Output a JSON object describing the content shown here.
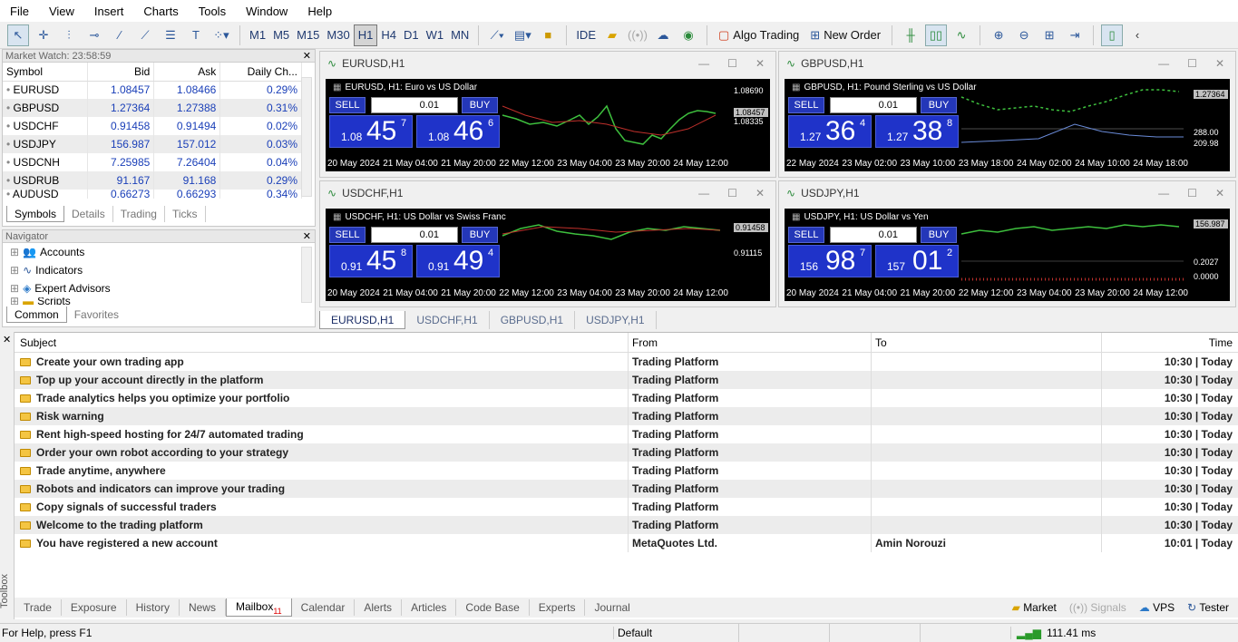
{
  "menu": [
    "File",
    "View",
    "Insert",
    "Charts",
    "Tools",
    "Window",
    "Help"
  ],
  "toolbar": {
    "timeframes": [
      "M1",
      "M5",
      "M15",
      "M30",
      "H1",
      "H4",
      "D1",
      "W1",
      "MN"
    ],
    "active_tf": "H1",
    "ide": "IDE",
    "algo": "Algo Trading",
    "new_order": "New Order"
  },
  "market_watch": {
    "title": "Market Watch: 23:58:59",
    "headers": [
      "Symbol",
      "Bid",
      "Ask",
      "Daily Ch..."
    ],
    "rows": [
      [
        "EURUSD",
        "1.08457",
        "1.08466",
        "0.29%"
      ],
      [
        "GBPUSD",
        "1.27364",
        "1.27388",
        "0.31%"
      ],
      [
        "USDCHF",
        "0.91458",
        "0.91494",
        "0.02%"
      ],
      [
        "USDJPY",
        "156.987",
        "157.012",
        "0.03%"
      ],
      [
        "USDCNH",
        "7.25985",
        "7.26404",
        "0.04%"
      ],
      [
        "USDRUB",
        "91.167",
        "91.168",
        "0.29%"
      ],
      [
        "AUDUSD",
        "0.66273",
        "0.66293",
        "0.34%"
      ]
    ],
    "tabs": [
      "Symbols",
      "Details",
      "Trading",
      "Ticks"
    ]
  },
  "navigator": {
    "title": "Navigator",
    "items": [
      "Accounts",
      "Indicators",
      "Expert Advisors",
      "Scripts"
    ],
    "tabs": [
      "Common",
      "Favorites"
    ]
  },
  "charts": [
    {
      "win": "EURUSD,H1",
      "title": "EURUSD, H1:  Euro vs US Dollar",
      "lot": "0.01",
      "sell": "SELL",
      "buy": "BUY",
      "bid_small": "1.08",
      "bid_big": "45",
      "bid_sup": "7",
      "ask_small": "1.08",
      "ask_big": "46",
      "ask_sup": "6",
      "x": [
        "20 May 2024",
        "21 May 04:00",
        "21 May 20:00",
        "22 May 12:00",
        "23 May 04:00",
        "23 May 20:00",
        "24 May 12:00"
      ],
      "y": [
        "1.08690",
        "1.08457",
        "1.08335"
      ]
    },
    {
      "win": "GBPUSD,H1",
      "title": "GBPUSD, H1:  Pound Sterling vs US Dollar",
      "lot": "0.01",
      "sell": "SELL",
      "buy": "BUY",
      "bid_small": "1.27",
      "bid_big": "36",
      "bid_sup": "4",
      "ask_small": "1.27",
      "ask_big": "38",
      "ask_sup": "8",
      "x": [
        "22 May 2024",
        "23 May 02:00",
        "23 May 10:00",
        "23 May 18:00",
        "24 May 02:00",
        "24 May 10:00",
        "24 May 18:00"
      ],
      "y": [
        "1.27364",
        "288.00",
        "209.98"
      ]
    },
    {
      "win": "USDCHF,H1",
      "title": "USDCHF, H1:  US Dollar vs Swiss Franc",
      "lot": "0.01",
      "sell": "SELL",
      "buy": "BUY",
      "bid_small": "0.91",
      "bid_big": "45",
      "bid_sup": "8",
      "ask_small": "0.91",
      "ask_big": "49",
      "ask_sup": "4",
      "x": [
        "20 May 2024",
        "21 May 04:00",
        "21 May 20:00",
        "22 May 12:00",
        "23 May 04:00",
        "23 May 20:00",
        "24 May 12:00"
      ],
      "y": [
        "0.91458",
        "0.91115"
      ]
    },
    {
      "win": "USDJPY,H1",
      "title": "USDJPY, H1:  US Dollar vs Yen",
      "lot": "0.01",
      "sell": "SELL",
      "buy": "BUY",
      "bid_small": "156",
      "bid_big": "98",
      "bid_sup": "7",
      "ask_small": "157",
      "ask_big": "01",
      "ask_sup": "2",
      "x": [
        "20 May 2024",
        "21 May 04:00",
        "21 May 20:00",
        "22 May 12:00",
        "23 May 04:00",
        "23 May 20:00",
        "24 May 12:00"
      ],
      "y": [
        "156.987",
        "0.2027",
        "0.0000"
      ]
    }
  ],
  "chart_tabs": [
    "EURUSD,H1",
    "USDCHF,H1",
    "GBPUSD,H1",
    "USDJPY,H1"
  ],
  "mailbox": {
    "headers": [
      "Subject",
      "From",
      "To",
      "Time"
    ],
    "rows": [
      [
        "Create your own trading app",
        "Trading Platform",
        "",
        "10:30 | Today"
      ],
      [
        "Top up your account directly in the platform",
        "Trading Platform",
        "",
        "10:30 | Today"
      ],
      [
        "Trade analytics helps you optimize your portfolio",
        "Trading Platform",
        "",
        "10:30 | Today"
      ],
      [
        "Risk warning",
        "Trading Platform",
        "",
        "10:30 | Today"
      ],
      [
        "Rent high-speed hosting for 24/7 automated trading",
        "Trading Platform",
        "",
        "10:30 | Today"
      ],
      [
        "Order your own robot according to your strategy",
        "Trading Platform",
        "",
        "10:30 | Today"
      ],
      [
        "Trade anytime, anywhere",
        "Trading Platform",
        "",
        "10:30 | Today"
      ],
      [
        "Robots and indicators can improve your trading",
        "Trading Platform",
        "",
        "10:30 | Today"
      ],
      [
        "Copy signals of successful traders",
        "Trading Platform",
        "",
        "10:30 | Today"
      ],
      [
        "Welcome to the trading platform",
        "Trading Platform",
        "",
        "10:30 | Today"
      ],
      [
        "You have registered a new account",
        "MetaQuotes Ltd.",
        "Amin Norouzi",
        "10:01 | Today"
      ]
    ]
  },
  "bottom_tabs": [
    "Trade",
    "Exposure",
    "History",
    "News",
    "Mailbox",
    "Calendar",
    "Alerts",
    "Articles",
    "Code Base",
    "Experts",
    "Journal"
  ],
  "mailbox_badge": "11",
  "bottom_right": [
    "Market",
    "Signals",
    "VPS",
    "Tester"
  ],
  "toolbox_label": "Toolbox",
  "status": {
    "help": "For Help, press F1",
    "profile": "Default",
    "ping": "111.41 ms"
  }
}
